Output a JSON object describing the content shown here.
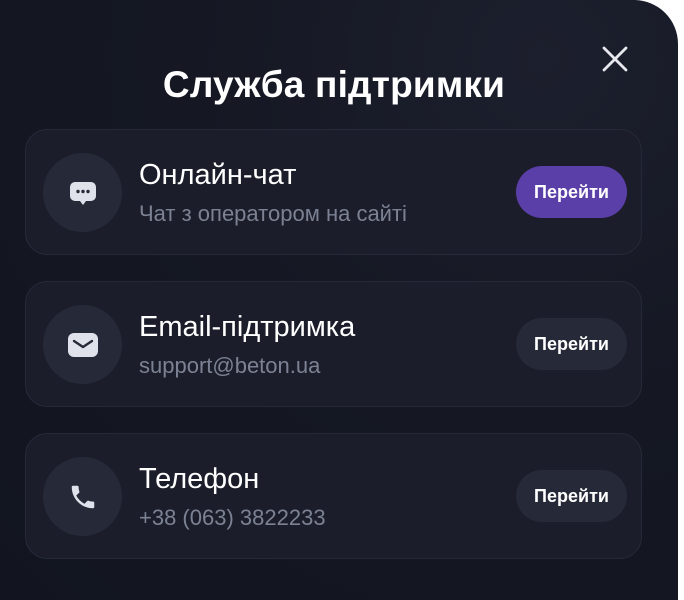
{
  "dialog": {
    "title": "Служба підтримки",
    "close_icon": "close-icon"
  },
  "colors": {
    "accent": "#5b3fa8",
    "card_bg": "#1b1e2a",
    "icon_bg": "#262a38",
    "subtitle": "#7c8293"
  },
  "options": [
    {
      "icon": "chat-bubble-icon",
      "title": "Онлайн-чат",
      "subtitle": "Чат з оператором на сайті",
      "button_label": "Перейти"
    },
    {
      "icon": "envelope-icon",
      "title": "Email-підтримка",
      "subtitle": "support@beton.ua",
      "button_label": "Перейти"
    },
    {
      "icon": "phone-icon",
      "title": "Телефон",
      "subtitle": "+38 (063) 3822233",
      "button_label": "Перейти"
    }
  ]
}
